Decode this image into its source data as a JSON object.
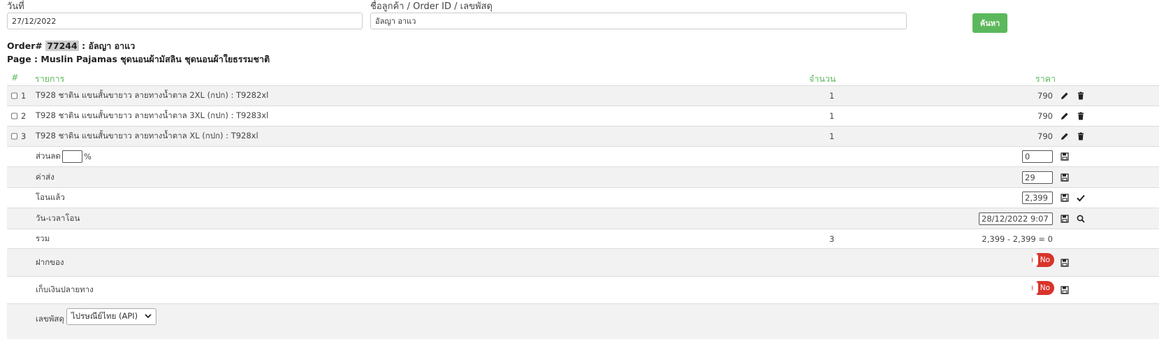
{
  "search": {
    "date_label": "วันที่",
    "date_value": "27/12/2022",
    "customer_label": "ชื่อลูกค้า / Order ID / เลขพัสดุ",
    "customer_value": "อัลญา อาแว",
    "button_label": "ค้นหา"
  },
  "order": {
    "prefix": "Order#",
    "id": "77244",
    "separator": ":",
    "customer": "อัลญา อาแว",
    "page_prefix": "Page :",
    "page_name": "Muslin Pajamas ชุดนอนผ้ามัสลิน ชุดนอนผ้าใยธรรมชาติ"
  },
  "table": {
    "headers": {
      "num": "#",
      "item": "รายการ",
      "qty": "จำนวน",
      "price": "ราคา"
    },
    "items": [
      {
        "num": "1",
        "name": "T928 ชาติน แขนสั้นขายาว ลายทางน้ำตาล 2XL (กปก) : T9282xl",
        "qty": "1",
        "price": "790"
      },
      {
        "num": "2",
        "name": "T928 ชาติน แขนสั้นขายาว ลายทางน้ำตาล 3XL (กปก) : T9283xl",
        "qty": "1",
        "price": "790"
      },
      {
        "num": "3",
        "name": "T928 ชาติน แขนสั้นขายาว ลายทางน้ำตาล XL (กปก) : T928xl",
        "qty": "1",
        "price": "790"
      }
    ]
  },
  "summary": {
    "discount_label": "ส่วนลด",
    "discount_percent_value": "",
    "percent_sign": "%",
    "discount_value": "0",
    "shipping_label": "ค่าส่ง",
    "shipping_value": "29",
    "paid_label": "โอนแล้ว",
    "paid_value": "2,399",
    "transfer_time_label": "วัน-เวลาโอน",
    "transfer_time_value": "28/12/2022 9:07",
    "total_label": "รวม",
    "total_qty": "3",
    "total_calc": "2,399 - 2,399 = 0",
    "deposit_label": "ฝากของ",
    "deposit_toggle": "No",
    "cod_label": "เก็บเงินปลายทาง",
    "cod_toggle": "No",
    "tracking_label": "เลขพัสดุ",
    "tracking_select": "ไปรษณีย์ไทย (API)"
  },
  "icons": {
    "edit": "pencil-icon",
    "delete": "trash-icon",
    "save": "floppy-disk-icon",
    "check": "check-icon",
    "search": "search-icon",
    "dropdown": "chevron-down-icon"
  },
  "colors": {
    "accent_green": "#5cb85c",
    "toggle_red": "#d9342b",
    "row_alt": "#f2f2f2"
  }
}
